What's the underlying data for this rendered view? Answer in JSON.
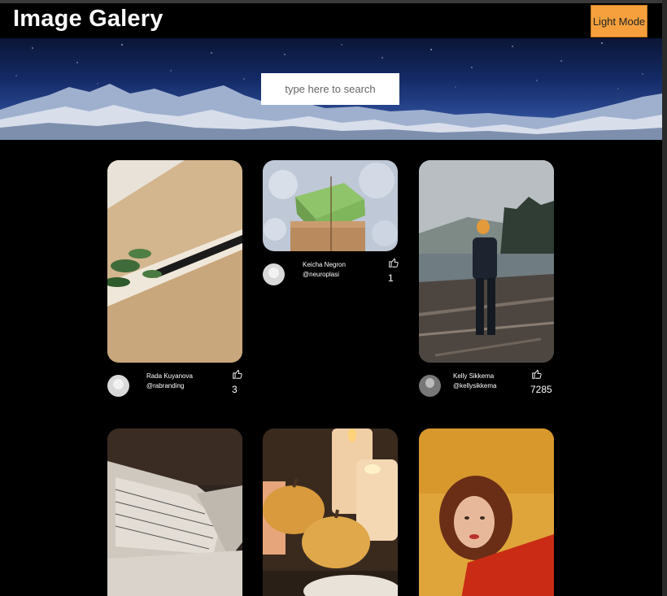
{
  "app": {
    "title": "Image Galery",
    "mode_button": "Light Mode"
  },
  "search": {
    "placeholder": "type here to search"
  },
  "cards": [
    {
      "name": "Rada Kuyanova",
      "handle": "@rabranding",
      "likes": "3",
      "image": "plant-shelf"
    },
    {
      "name": "Keicha Negron",
      "handle": "@neuroplasi",
      "likes": "1",
      "image": "gift-boxes"
    },
    {
      "name": "Kelly Sikkema",
      "handle": "@kellysikkema",
      "likes": "7285",
      "image": "lake-woman"
    },
    {
      "image": "pillows"
    },
    {
      "image": "pumpkins-candles"
    },
    {
      "image": "woman-red-sweater"
    }
  ],
  "icons": {
    "like": "thumbs-up-icon",
    "avatar": "user-avatar-icon"
  },
  "colors": {
    "background": "#000000",
    "accent_button": "#f5a03d",
    "text": "#ffffff"
  }
}
